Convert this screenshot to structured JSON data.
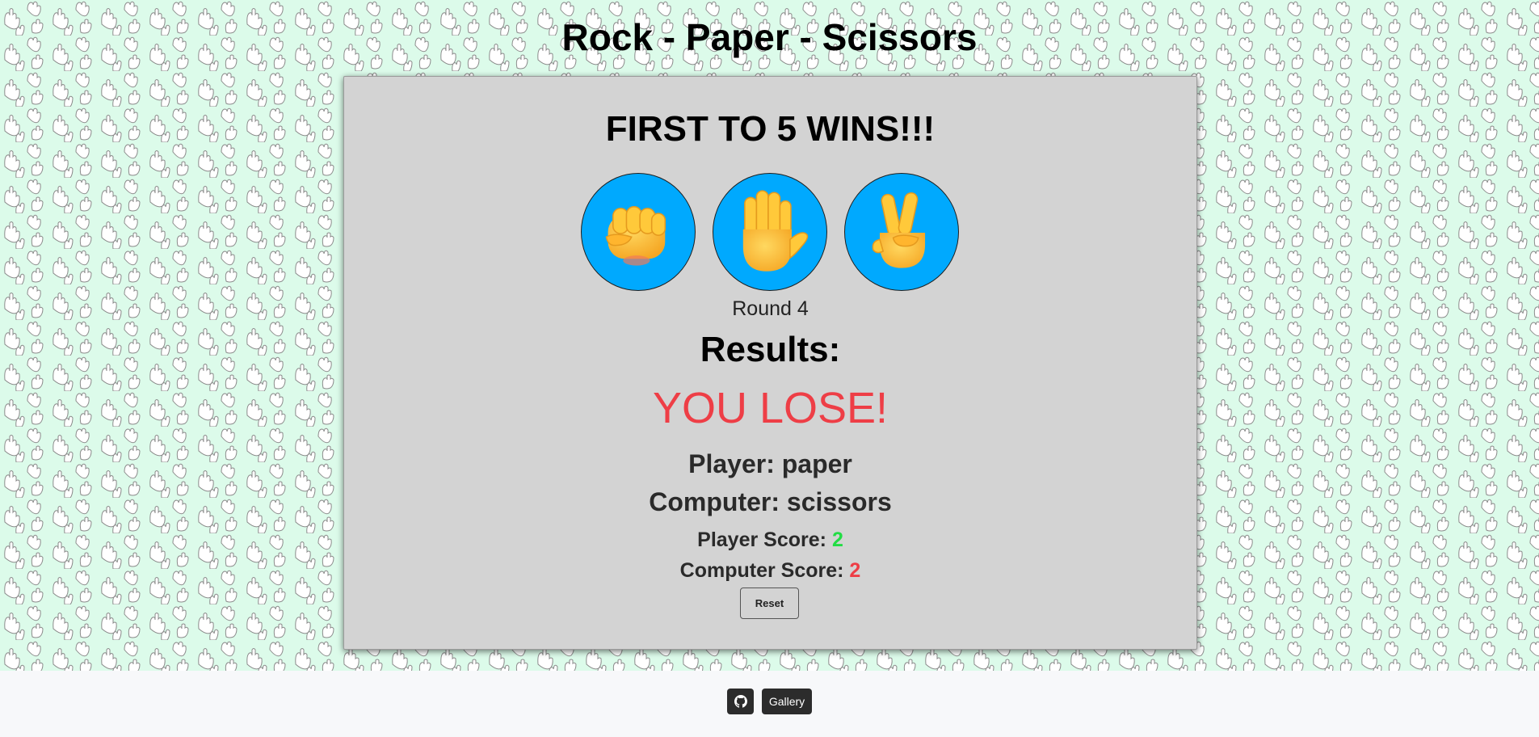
{
  "page": {
    "title": "Rock - Paper - Scissors"
  },
  "game": {
    "heading": "FIRST TO 5 WINS!!!",
    "choices": [
      {
        "name": "rock",
        "icon": "fist-icon"
      },
      {
        "name": "paper",
        "icon": "raised-hand-icon"
      },
      {
        "name": "scissors",
        "icon": "victory-hand-icon"
      }
    ],
    "round_label": "Round 4",
    "results_heading": "Results:",
    "outcome": "YOU LOSE!",
    "player_choice": "Player: paper",
    "computer_choice": "Computer: scissors",
    "player_score_label": "Player Score:",
    "player_score": "2",
    "computer_score_label": "Computer Score:",
    "computer_score": "2",
    "reset_label": "Reset"
  },
  "footer": {
    "github_icon": "github-icon",
    "gallery_label": "Gallery"
  },
  "colors": {
    "background": "#dcfbea",
    "card": "#d3d3d3",
    "choice_button": "#00a9fe",
    "lose": "#ee3e46",
    "win_score": "#22dd44",
    "footer_button": "#2c2c2c"
  }
}
